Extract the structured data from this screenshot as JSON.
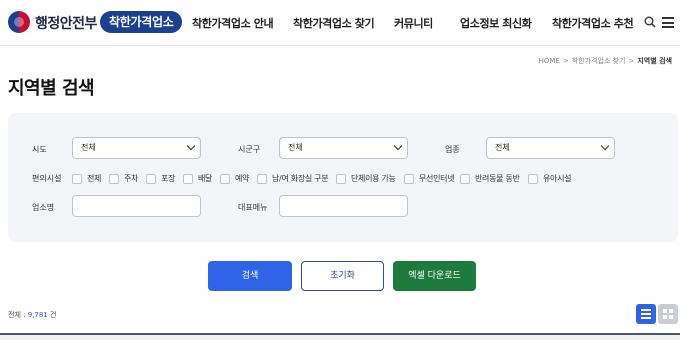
{
  "header": {
    "logo_text": "행정안전부",
    "badge_text": "착한가격업소",
    "nav": [
      "착한가격업소 안내",
      "착한가격업소 찾기",
      "커뮤니티",
      "업소정보 최신화",
      "착한가격업소 추천"
    ]
  },
  "breadcrumb": [
    "HOME",
    "착한가격업소 찾기",
    "지역별 검색"
  ],
  "page_title": "지역별 검색",
  "filters": {
    "sido_label": "시도",
    "sido_value": "전체",
    "sigungu_label": "시군구",
    "sigungu_value": "전체",
    "industry_label": "업종",
    "industry_value": "전체",
    "amenities_label": "편의시설",
    "amenities": [
      "전체",
      "주차",
      "포장",
      "배달",
      "예약",
      "남/여 화장실 구분",
      "단체이용 가능",
      "무선인터넷",
      "반려동물 동반",
      "유아시설"
    ],
    "name_label": "업소명",
    "name_value": "",
    "menu_label": "대표메뉴",
    "menu_value": ""
  },
  "buttons": {
    "search": "검색",
    "reset": "초기화",
    "excel": "엑셀 다운로드"
  },
  "total": {
    "prefix": "전체 : ",
    "count": "9,781",
    "suffix": " 건"
  },
  "colors": {
    "primary": "#2f64e6",
    "brand_navy": "#1d3f8f",
    "excel_green": "#1f7a3e",
    "panel_bg": "#f4f5f8"
  },
  "icons": {
    "search": "search-icon",
    "menu": "hamburger-menu-icon",
    "list_view": "list-view-icon",
    "grid_view": "grid-view-icon"
  }
}
